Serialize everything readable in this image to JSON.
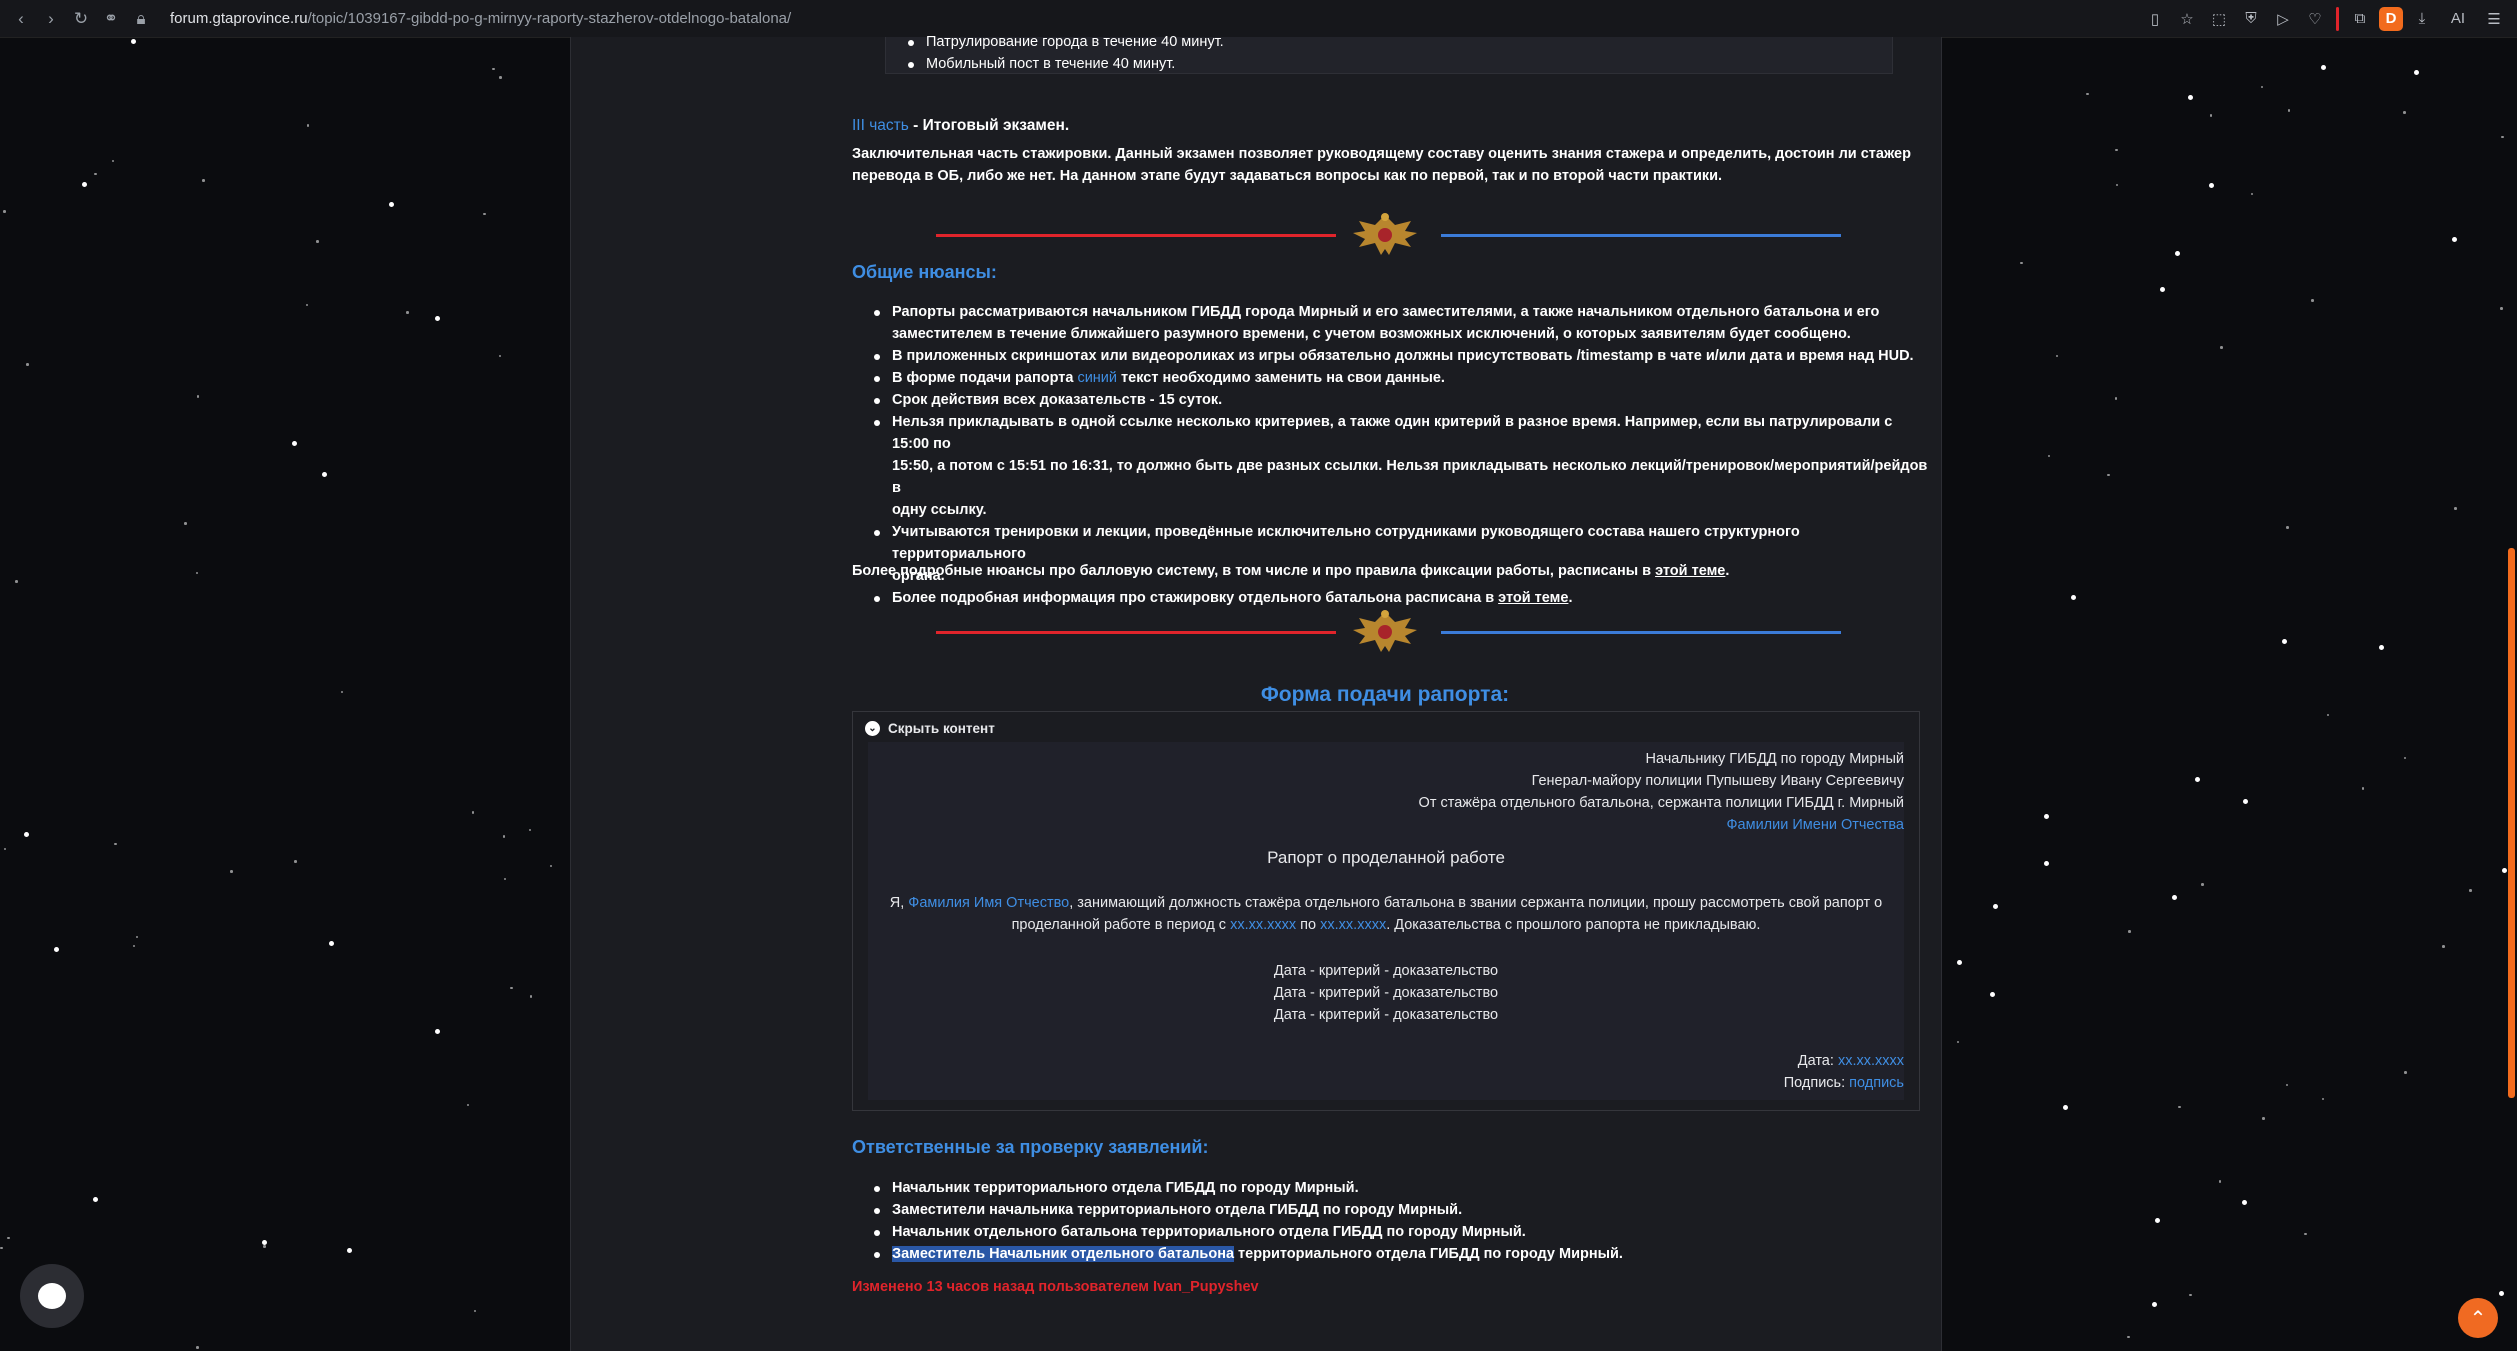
{
  "browser": {
    "url_host": "forum.gtaprovince.ru",
    "url_path": "/topic/1039167-gibdd-po-g-mirnyy-raporty-stazherov-otdelnogo-batalona/",
    "profile_badge": "D",
    "ai_label": "AI"
  },
  "top_list": [
    "Патрулирование города в течение 40 минут.",
    "Мобильный пост в течение 40 минут."
  ],
  "part3": {
    "label": "III часть",
    "title": " - Итоговый экзамен.",
    "line1": "Заключительная часть стажировки. Данный экзамен позволяет руководящему составу оценить знания стажера и определить, достоин ли стажер",
    "line2": "перевода в ОБ, либо же нет. На данном этапе будут задаваться вопросы как по первой, так и по второй части практики."
  },
  "nuances": {
    "title": "Общие нюансы:",
    "items": [
      {
        "l1": "Рапорты рассматриваются начальником ГИБДД города Мирный и его заместителями, а также начальником отдельного батальона и его",
        "l2": "заместителем в течение ближайшего разумного времени, с учетом возможных исключений, о которых заявителям будет сообщено."
      },
      {
        "l1": "В приложенных скриншотах или видеороликах из игры обязательно должны присутствовать /timestamp в чате и/или дата и время над HUD."
      },
      {
        "pre": "В форме подачи рапорта ",
        "blue": "синий",
        "post": " текст необходимо заменить на свои данные."
      },
      {
        "l1": "Срок действия всех доказательств - 15 суток."
      },
      {
        "l1": "Нельзя прикладывать в одной ссылке несколько критериев, а также один критерий в разное время. Например, если вы патрулировали с 15:00 по",
        "l2": "15:50, а потом с 15:51 по 16:31, то должно быть две разных ссылки. Нельзя прикладывать несколько лекций/тренировок/мероприятий/рейдов в",
        "l3": "одну ссылку."
      },
      {
        "l1": "Учитываются тренировки и лекции, проведённые исключительно сотрудниками руководящего состава нашего структурного территориального",
        "l2": "органа."
      },
      {
        "pre": "Более подробная информация про стажировку отдельного батальона расписана в ",
        "link": "этой теме",
        "post": "."
      }
    ],
    "footer_pre": "Более подробные нюансы про балловую систему, в том числе и про правила фиксации работы, расписаны в ",
    "footer_link": "этой теме",
    "footer_post": "."
  },
  "form": {
    "title": "Форма подачи рапорта:",
    "toggle": "Скрыть контент",
    "to1": "Начальнику ГИБДД по городу Мирный",
    "to2": "Генерал-майору полиции Пупышеву Ивану Сергеевичу",
    "from": "От стажёра отдельного батальона, сержанта полиции ГИБДД г. Мирный",
    "from_name": "Фамилии Имени Отчества",
    "heading": "Рапорт о проделанной работе",
    "body_1": "Я, ",
    "body_name": "Фамилия Имя Отчество",
    "body_2": ", занимающий должность стажёра отдельного батальона в звании сержанта полиции, прошу рассмотреть свой рапорт о",
    "body_3": "проделанной работе в период с ",
    "date_from": "xx.xx.xxxx",
    "body_4": " по ",
    "date_to": "xx.xx.xxxx",
    "body_5": ". Доказательства с прошлого рапорта не прикладываю.",
    "criteria": [
      "Дата - критерий - доказательство",
      "Дата - критерий - доказательство",
      "Дата - критерий - доказательство"
    ],
    "date_label": "Дата: ",
    "date_value": "xx.xx.xxxx",
    "sign_label": "Подпись: ",
    "sign_value": "подпись"
  },
  "responsible": {
    "title": "Ответственные за проверку заявлений:",
    "items": [
      "Начальник территориального отдела ГИБДД по городу Мирный.",
      "Заместители начальника территориального отдела ГИБДД по городу Мирный.",
      "Начальник отдельного батальона территориального отдела ГИБДД по городу Мирный."
    ],
    "last_highlight": "Заместитель Начальник отдельного батальона",
    "last_rest": " территориального отдела ГИБДД по городу Мирный."
  },
  "edited": "Изменено 13 часов назад пользователем Ivan_Pupyshev",
  "colors": {
    "accent": "#3f8ee3",
    "red": "#e0242b",
    "orange": "#f06a22"
  }
}
